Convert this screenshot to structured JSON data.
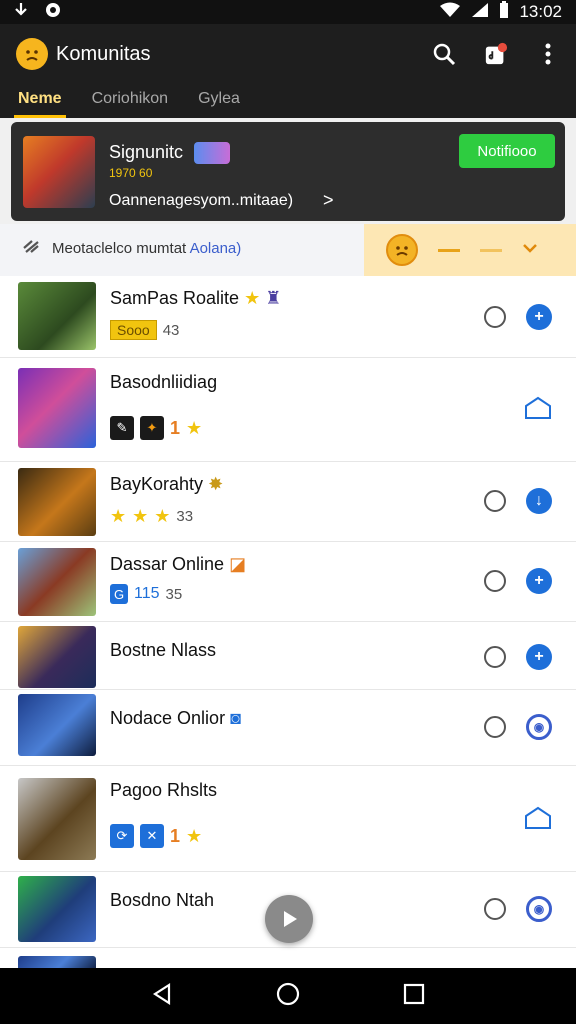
{
  "status_bar": {
    "time": "13:02"
  },
  "app_bar": {
    "title": "Komunitas"
  },
  "tabs": [
    {
      "label": "Neme",
      "active": true
    },
    {
      "label": "Coriohikon",
      "active": false
    },
    {
      "label": "Gylea",
      "active": false
    }
  ],
  "featured": {
    "name": "Signunitc",
    "sub": "1970 60",
    "line": "Oannenagesyom..mitaae)",
    "button_label": "Notifiooo"
  },
  "filter": {
    "text": "Meotaclelco mumtat",
    "link": "Aolana)"
  },
  "games": [
    {
      "title": "SamPas Roalite",
      "tag": "Sooo",
      "count": "43"
    },
    {
      "title": "Basodnliidiag",
      "number": "1"
    },
    {
      "title": "BayKorahty",
      "count": "33"
    },
    {
      "title": "Dassar Online",
      "number": "115",
      "count": "35"
    },
    {
      "title": "Bostne Nlass"
    },
    {
      "title": "Nodace Onlior"
    },
    {
      "title": "Pagoo Rhslts",
      "number": "1"
    },
    {
      "title": "Bosdno Ntah"
    }
  ],
  "colors": {
    "accent_blue": "#1e6fd9",
    "notify_green": "#2ecc40",
    "tab_active": "#ffc107",
    "filter_highlight": "#fde7b4"
  }
}
